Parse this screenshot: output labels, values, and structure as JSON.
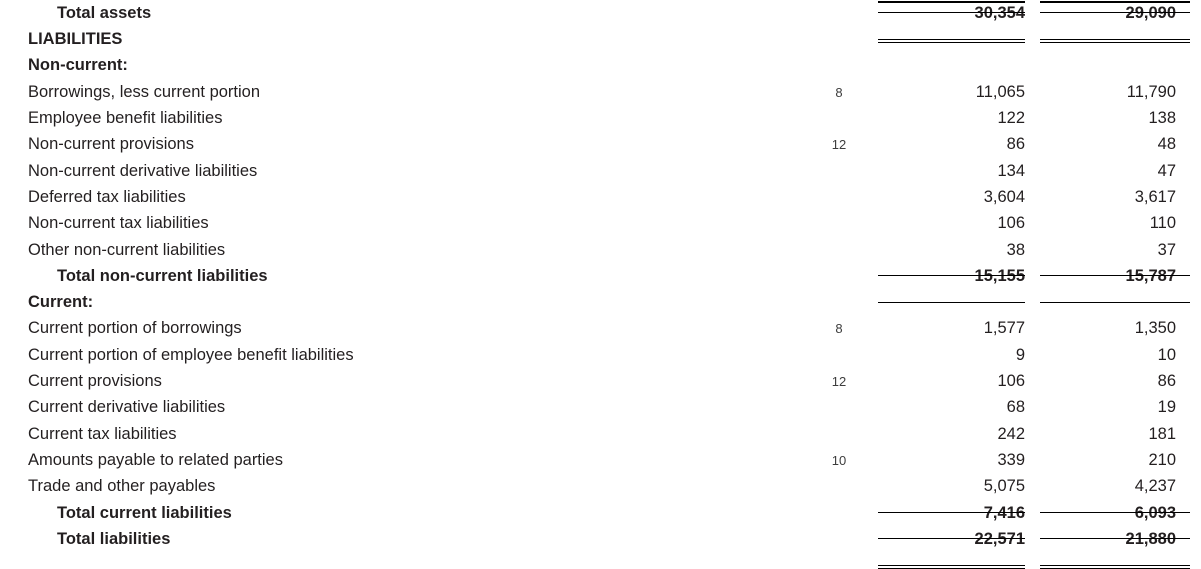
{
  "statement": {
    "section_headings": {
      "liabilities": "LIABILITIES",
      "non_current": "Non-current:",
      "current": "Current:"
    },
    "rows": [
      {
        "label": "Total assets",
        "note": "",
        "col1": "30,354",
        "col2": "29,090",
        "style": "total",
        "rule_above": "single",
        "rule_below": "double"
      },
      {
        "label": "LIABILITIES",
        "note": "",
        "col1": "",
        "col2": "",
        "style": "heading"
      },
      {
        "label": "Non-current:",
        "note": "",
        "col1": "",
        "col2": "",
        "style": "heading"
      },
      {
        "label": "Borrowings, less current portion",
        "note": "8",
        "col1": "11,065",
        "col2": "11,790",
        "style": "item"
      },
      {
        "label": "Employee benefit liabilities",
        "note": "",
        "col1": "122",
        "col2": "138",
        "style": "item"
      },
      {
        "label": "Non-current provisions",
        "note": "12",
        "col1": "86",
        "col2": "48",
        "style": "item"
      },
      {
        "label": "Non-current derivative liabilities",
        "note": "",
        "col1": "134",
        "col2": "47",
        "style": "item"
      },
      {
        "label": "Deferred tax liabilities",
        "note": "",
        "col1": "3,604",
        "col2": "3,617",
        "style": "item"
      },
      {
        "label": "Non-current tax liabilities",
        "note": "",
        "col1": "106",
        "col2": "110",
        "style": "item"
      },
      {
        "label": "Other non-current liabilities",
        "note": "",
        "col1": "38",
        "col2": "37",
        "style": "item"
      },
      {
        "label": "Total non-current liabilities",
        "note": "",
        "col1": "15,155",
        "col2": "15,787",
        "style": "total",
        "rule_above": "single",
        "rule_below": "single"
      },
      {
        "label": "Current:",
        "note": "",
        "col1": "",
        "col2": "",
        "style": "heading"
      },
      {
        "label": "Current portion of borrowings",
        "note": "8",
        "col1": "1,577",
        "col2": "1,350",
        "style": "item"
      },
      {
        "label": "Current portion of employee benefit liabilities",
        "note": "",
        "col1": "9",
        "col2": "10",
        "style": "item"
      },
      {
        "label": "Current provisions",
        "note": "12",
        "col1": "106",
        "col2": "86",
        "style": "item"
      },
      {
        "label": "Current derivative liabilities",
        "note": "",
        "col1": "68",
        "col2": "19",
        "style": "item"
      },
      {
        "label": "Current tax liabilities",
        "note": "",
        "col1": "242",
        "col2": "181",
        "style": "item"
      },
      {
        "label": "Amounts payable to related parties",
        "note": "10",
        "col1": "339",
        "col2": "210",
        "style": "item"
      },
      {
        "label": "Trade and other payables",
        "note": "",
        "col1": "5,075",
        "col2": "4,237",
        "style": "item"
      },
      {
        "label": "Total current liabilities",
        "note": "",
        "col1": "7,416",
        "col2": "6,093",
        "style": "total",
        "rule_above": "single"
      },
      {
        "label": "Total liabilities",
        "note": "",
        "col1": "22,571",
        "col2": "21,880",
        "style": "total",
        "rule_above": "single",
        "rule_below": "double"
      }
    ]
  }
}
